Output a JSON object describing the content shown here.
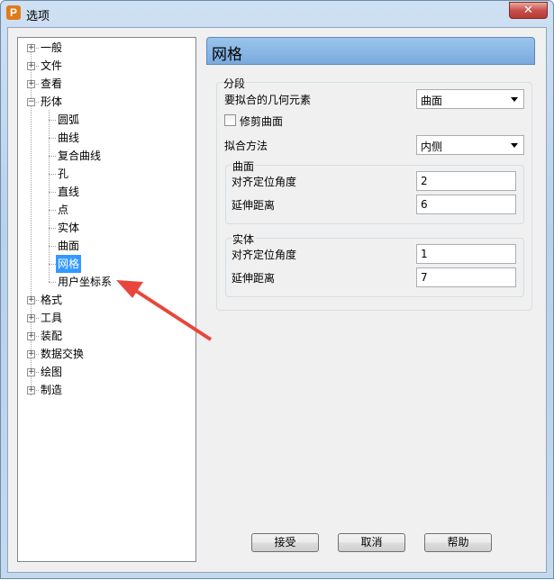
{
  "window": {
    "title": "选项",
    "app_icon_letter": "P",
    "close_symbol": "✕"
  },
  "tree": {
    "items": [
      {
        "label": "一般",
        "level": 0,
        "expander": "+"
      },
      {
        "label": "文件",
        "level": 0,
        "expander": "+"
      },
      {
        "label": "查看",
        "level": 0,
        "expander": "+"
      },
      {
        "label": "形体",
        "level": 0,
        "expander": "−"
      },
      {
        "label": "圆弧",
        "level": 1
      },
      {
        "label": "曲线",
        "level": 1
      },
      {
        "label": "复合曲线",
        "level": 1
      },
      {
        "label": "孔",
        "level": 1
      },
      {
        "label": "直线",
        "level": 1
      },
      {
        "label": "点",
        "level": 1
      },
      {
        "label": "实体",
        "level": 1
      },
      {
        "label": "曲面",
        "level": 1
      },
      {
        "label": "网格",
        "level": 1,
        "selected": true
      },
      {
        "label": "用户坐标系",
        "level": 1
      },
      {
        "label": "格式",
        "level": 0,
        "expander": "+"
      },
      {
        "label": "工具",
        "level": 0,
        "expander": "+"
      },
      {
        "label": "装配",
        "level": 0,
        "expander": "+"
      },
      {
        "label": "数据交换",
        "level": 0,
        "expander": "+"
      },
      {
        "label": "绘图",
        "level": 0,
        "expander": "+"
      },
      {
        "label": "制造",
        "level": 0,
        "expander": "+"
      }
    ]
  },
  "panel": {
    "title": "网格",
    "segment_group": "分段",
    "fit_geometry_label": "要拟合的几何元素",
    "fit_geometry_value": "曲面",
    "trim_surface_label": "修剪曲面",
    "fit_method_label": "拟合方法",
    "fit_method_value": "内侧",
    "surface_group": {
      "title": "曲面",
      "angle_label": "对齐定位角度",
      "angle_value": "2",
      "extend_label": "延伸距离",
      "extend_value": "6"
    },
    "solid_group": {
      "title": "实体",
      "angle_label": "对齐定位角度",
      "angle_value": "1",
      "extend_label": "延伸距离",
      "extend_value": "7"
    }
  },
  "buttons": {
    "ok": "接受",
    "cancel": "取消",
    "help": "帮助"
  },
  "colors": {
    "selection": "#3399ff",
    "header": "#8fbbe8",
    "annotation_arrow": "#e8463c"
  }
}
